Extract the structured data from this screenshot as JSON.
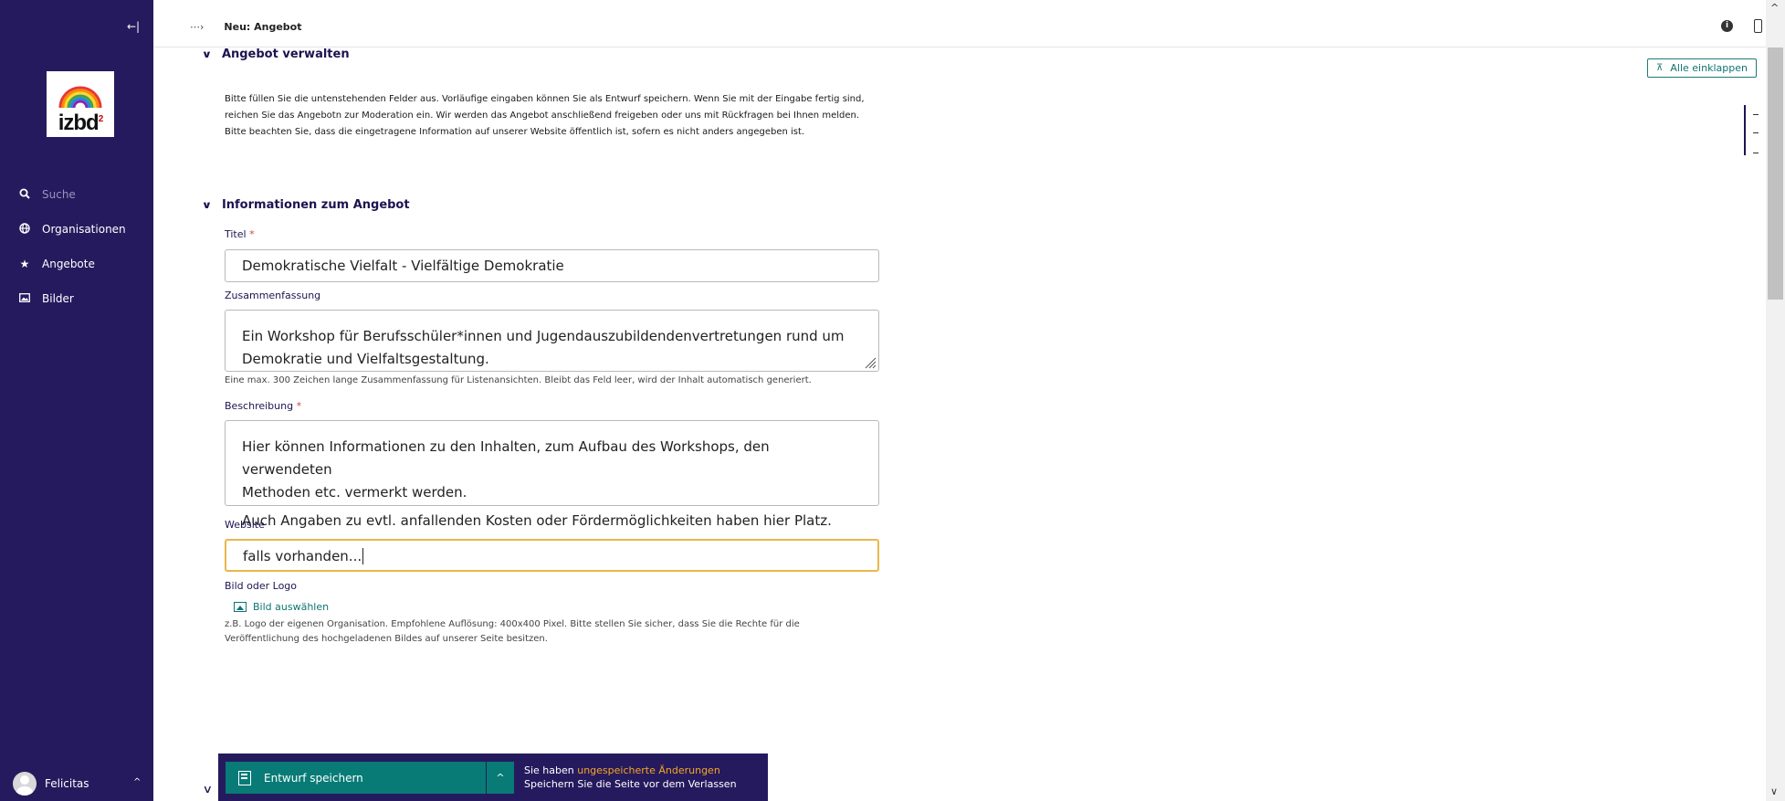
{
  "sidebar": {
    "collapse_icon": "collapse-left-icon",
    "logo_text": "izbd",
    "logo_sup": "2",
    "search_label": "Suche",
    "items": [
      {
        "label": "Organisationen",
        "icon": "globe-icon"
      },
      {
        "label": "Angebote",
        "icon": "star-icon"
      },
      {
        "label": "Bilder",
        "icon": "image-icon"
      }
    ],
    "user": {
      "name": "Felicitas"
    }
  },
  "header": {
    "breadcrumb": "Neu: Angebot"
  },
  "main": {
    "collapse_all_label": "Alle einklappen",
    "section1": {
      "title": "Angebot verwalten",
      "intro": [
        "Bitte füllen Sie die untenstehenden Felder aus. Vorläufige eingaben können Sie als Entwurf speichern. Wenn Sie mit der Eingabe fertig sind,",
        "reichen Sie das Angebotn zur Moderation ein. Wir werden das Angebot anschließend freigeben oder uns mit Rückfragen bei Ihnen melden.",
        "Bitte beachten Sie, dass die eingetragene Information auf unserer Website öffentlich ist, sofern es nicht anders angegeben ist."
      ]
    },
    "section2": {
      "title": "Informationen zum Angebot",
      "title_field": {
        "label": "Titel",
        "required": "*",
        "value": "Demokratische Vielfalt - Vielfältige Demokratie"
      },
      "summary_field": {
        "label": "Zusammenfassung",
        "value_line1": "Ein Workshop für Berufsschüler*innen und Jugendauszubildendenvertretungen rund um",
        "value_line2": "Demokratie und Vielfaltsgestaltung.",
        "help": "Eine max. 300 Zeichen lange Zusammenfassung für Listenansichten. Bleibt das Feld leer, wird der Inhalt automatisch generiert."
      },
      "description_field": {
        "label": "Beschreibung",
        "required": "*",
        "para1_line1": "Hier können Informationen zu den Inhalten, zum Aufbau des Workshops, den verwendeten",
        "para1_line2": "Methoden etc. vermerkt werden.",
        "para2": "Auch Angaben zu evtl. anfallenden Kosten oder Fördermöglichkeiten haben hier Platz."
      },
      "website_field": {
        "label": "Website",
        "value": "falls vorhanden..."
      },
      "image_field": {
        "label": "Bild oder Logo",
        "button": "Bild auswählen",
        "help_line1": "z.B. Logo der eigenen Organisation. Empfohlene Auflösung: 400x400 Pixel. Bitte stellen Sie sicher, dass Sie die Rechte für die",
        "help_line2": "Veröffentlichung des hochgeladenen Bildes auf unserer Seite besitzen."
      }
    }
  },
  "footer": {
    "save_label": "Entwurf speichern",
    "msg_prefix": "Sie haben ",
    "msg_highlight": "ungespeicherte Änderungen",
    "msg_line2": "Speichern Sie die Seite vor dem Verlassen"
  },
  "colors": {
    "sidebar_bg": "#261a5e",
    "accent_teal": "#087b76",
    "heading": "#1c1450",
    "focus_border": "#e9b74d",
    "warning_text": "#f5a623"
  }
}
